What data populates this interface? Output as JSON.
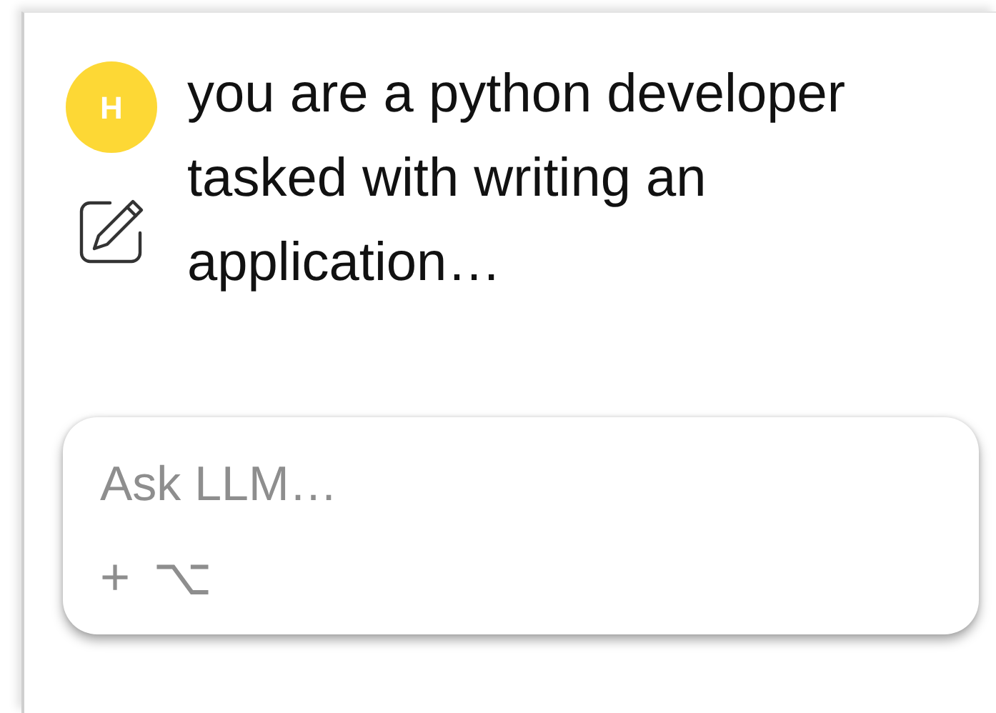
{
  "message": {
    "avatar": "H",
    "text": "you are a python developer tasked with writing an application…"
  },
  "composer": {
    "placeholder": "Ask LLM…",
    "actions": [
      "+",
      "⌥"
    ]
  }
}
